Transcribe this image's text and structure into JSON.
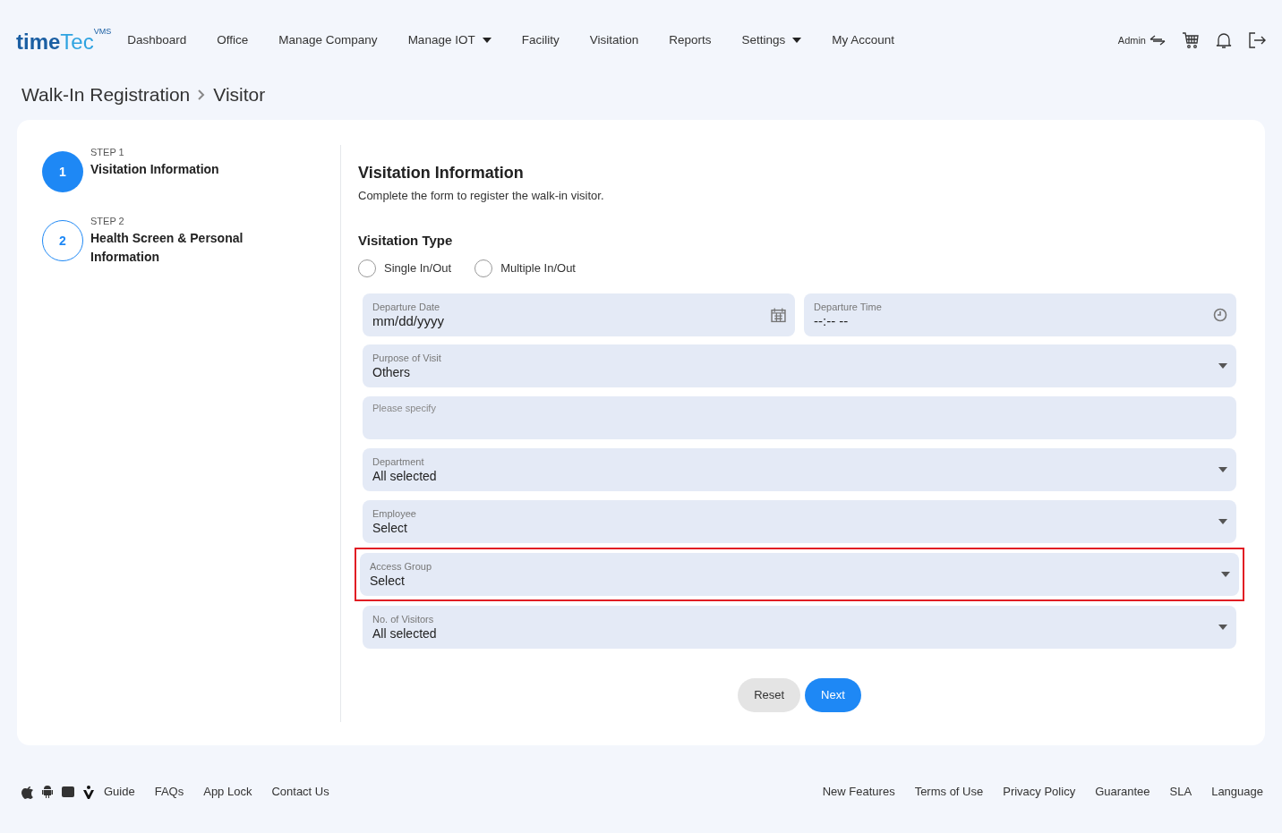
{
  "logo": {
    "part_1": "time",
    "part_2": "Tec",
    "badge": "VMS"
  },
  "nav": [
    {
      "label": "Dashboard",
      "dropdown": false
    },
    {
      "label": "Office",
      "dropdown": false
    },
    {
      "label": "Manage Company",
      "dropdown": false
    },
    {
      "label": "Manage IOT",
      "dropdown": true
    },
    {
      "label": "Facility",
      "dropdown": false
    },
    {
      "label": "Visitation",
      "dropdown": false
    },
    {
      "label": "Reports",
      "dropdown": false
    },
    {
      "label": "Settings",
      "dropdown": true
    },
    {
      "label": "My Account",
      "dropdown": false
    }
  ],
  "user": {
    "role": "Admin"
  },
  "breadcrumb": [
    "Walk-In Registration",
    "Visitor"
  ],
  "steps": [
    {
      "number": "1",
      "caption": "STEP 1",
      "title": "Visitation Information",
      "selected": true
    },
    {
      "number": "2",
      "caption": "STEP 2",
      "title": "Health Screen & Personal Information",
      "selected": false
    }
  ],
  "form": {
    "title": "Visitation Information",
    "subtitle": "Complete the form to register the walk-in visitor.",
    "type_heading": "Visitation Type",
    "type_options": [
      {
        "label": "Single In/Out",
        "selected": false
      },
      {
        "label": "Multiple In/Out",
        "selected": false
      }
    ],
    "date_row": [
      {
        "kind": "date",
        "label": "Departure Date",
        "value": "mm/dd/yyyy"
      },
      {
        "kind": "time",
        "label": "Departure Time",
        "value": "--:-- --"
      }
    ],
    "fields": [
      {
        "kind": "select",
        "label": "Purpose of Visit",
        "value": "Others",
        "highlighted": false
      },
      {
        "kind": "text",
        "placeholder": "Please specify",
        "highlighted": false
      },
      {
        "kind": "select",
        "label": "Department",
        "value": "All selected",
        "highlighted": false
      },
      {
        "kind": "select",
        "label": "Employee",
        "value": "Select",
        "highlighted": false
      },
      {
        "kind": "select",
        "label": "Access Group",
        "value": "Select",
        "highlighted": true
      },
      {
        "kind": "select",
        "label": "No. of Visitors",
        "value": "All selected",
        "highlighted": false
      }
    ],
    "buttons": [
      {
        "kind": "secondary",
        "label": "Reset"
      },
      {
        "kind": "primary",
        "label": "Next"
      }
    ]
  },
  "footer": {
    "left": [
      "Guide",
      "FAQs",
      "App Lock",
      "Contact Us"
    ],
    "right": [
      "New Features",
      "Terms of Use",
      "Privacy Policy",
      "Guarantee",
      "SLA",
      "Language"
    ]
  }
}
